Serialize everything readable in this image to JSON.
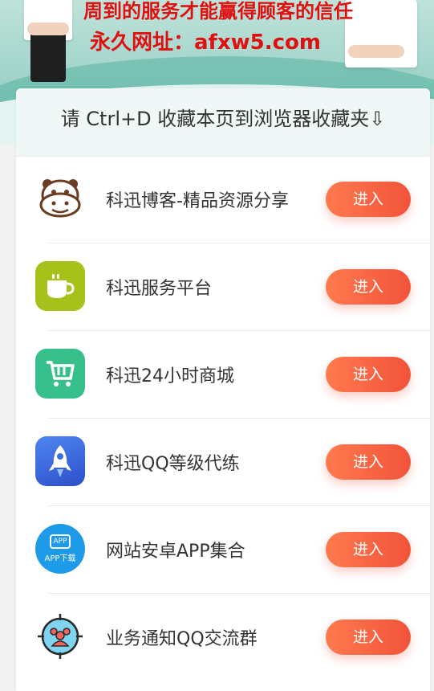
{
  "banner": {
    "slogan": "周到的服务才能赢得顾客的信任",
    "url_line": "永久网址：afxw5.com"
  },
  "notice": "请 Ctrl+D 收藏本页到浏览器收藏夹⇩",
  "items": [
    {
      "label": "科迅博客-精品资源分享",
      "button": "进入",
      "icon": "hippo-icon",
      "color": "#ffffff"
    },
    {
      "label": "科迅服务平台",
      "button": "进入",
      "icon": "coffee-cup-icon",
      "color": "#a6c21a"
    },
    {
      "label": "科迅24小时商城",
      "button": "进入",
      "icon": "shopping-cart-icon",
      "color": "#37c08b"
    },
    {
      "label": "科迅QQ等级代练",
      "button": "进入",
      "icon": "rocket-icon",
      "color": "#3b6fe0"
    },
    {
      "label": "网站安卓APP集合",
      "button": "进入",
      "icon": "app-download-icon",
      "color": "#1e9be8",
      "icon_text": "APP下载",
      "icon_badge": "APP"
    },
    {
      "label": "业务通知QQ交流群",
      "button": "进入",
      "icon": "group-users-icon",
      "color": "#2aa7e0"
    }
  ],
  "theme": {
    "button_start": "#ff7a4f",
    "button_end": "#f2533a",
    "banner": "#9fd3c8",
    "slogan_color": "#e01010"
  }
}
